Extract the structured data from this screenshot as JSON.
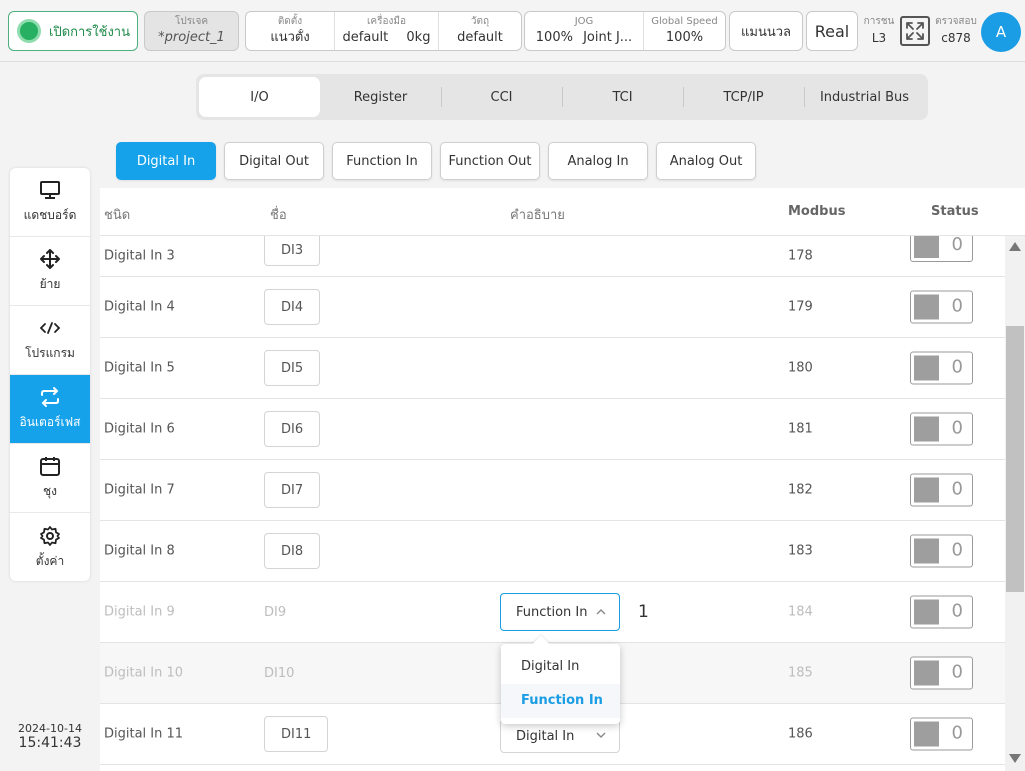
{
  "topbar": {
    "enable_label": "เปิดการใช้งาน",
    "project": {
      "caption": "โปรเจค",
      "value": "*project_1"
    },
    "install": {
      "caption": "ติดตั้ง",
      "value": "แนวตั้ง"
    },
    "tool": {
      "caption": "เครื่องมือ",
      "value": "default",
      "weight": "0kg"
    },
    "payload": {
      "caption": "วัตถุ",
      "value": "default"
    },
    "jog": {
      "caption": "JOG",
      "percent": "100%",
      "mode": "Joint J..."
    },
    "global_speed": {
      "caption": "Global Speed",
      "value": "100%"
    },
    "manual_label": "แมนนวล",
    "real_label": "Real",
    "collision": {
      "caption": "การชน",
      "value": "L3"
    },
    "check": {
      "caption": "ตรวจสอบ",
      "value": "c878"
    },
    "avatar": "A",
    "enable_color": "#27b062"
  },
  "sidebar": {
    "items": [
      {
        "label": "แดชบอร์ด",
        "icon": "monitor-icon"
      },
      {
        "label": "ย้าย",
        "icon": "move-icon"
      },
      {
        "label": "โปรแกรม",
        "icon": "code-icon"
      },
      {
        "label": "อินเตอร์เฟส",
        "icon": "interface-icon",
        "active": true
      },
      {
        "label": "ชุง",
        "icon": "calendar-icon"
      },
      {
        "label": "ตั้งค่า",
        "icon": "gear-icon"
      }
    ],
    "date": "2024-10-14",
    "time": "15:41:43",
    "active_color": "#16a2ea"
  },
  "tabs": [
    "I/O",
    "Register",
    "CCI",
    "TCI",
    "TCP/IP",
    "Industrial Bus"
  ],
  "subtabs": [
    "Digital In",
    "Digital Out",
    "Function In",
    "Function Out",
    "Analog In",
    "Analog Out"
  ],
  "table": {
    "headers": {
      "type": "ชนิด",
      "name": "ชื่อ",
      "desc": "คำอธิบาย",
      "modbus": "Modbus",
      "status": "Status"
    },
    "rows": [
      {
        "type": "Digital In 3",
        "name": "DI3",
        "modbus": "178",
        "status": "0"
      },
      {
        "type": "Digital In 4",
        "name": "DI4",
        "modbus": "179",
        "status": "0"
      },
      {
        "type": "Digital In 5",
        "name": "DI5",
        "modbus": "180",
        "status": "0"
      },
      {
        "type": "Digital In 6",
        "name": "DI6",
        "modbus": "181",
        "status": "0"
      },
      {
        "type": "Digital In 7",
        "name": "DI7",
        "modbus": "182",
        "status": "0"
      },
      {
        "type": "Digital In 8",
        "name": "DI8",
        "modbus": "183",
        "status": "0"
      },
      {
        "type": "Digital In 9",
        "name": "DI9",
        "modbus": "184",
        "status": "0",
        "select": "Function In",
        "select_value": "1"
      },
      {
        "type": "Digital In 10",
        "name": "DI10",
        "modbus": "185",
        "status": "0"
      },
      {
        "type": "Digital In 11",
        "name": "DI11",
        "modbus": "186",
        "status": "0",
        "select": "Digital In"
      }
    ]
  },
  "dropdown": {
    "options": [
      "Digital In",
      "Function In"
    ],
    "selected": "Function In"
  }
}
